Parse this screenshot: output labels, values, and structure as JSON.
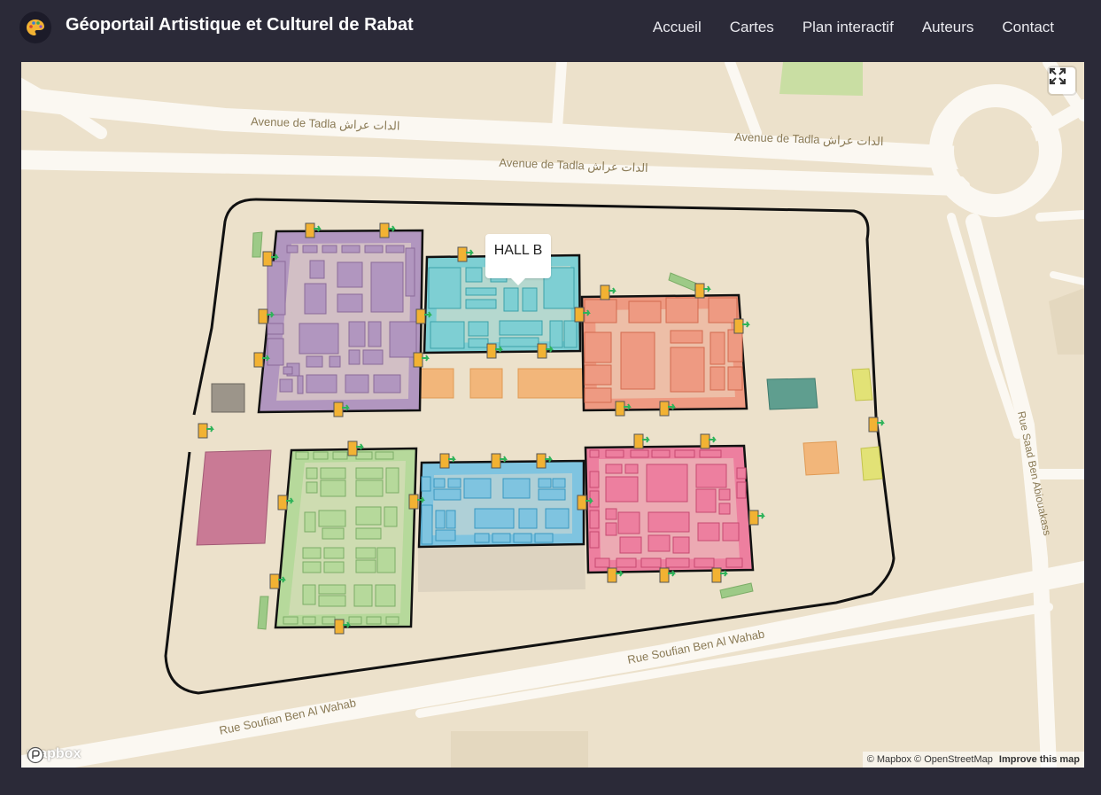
{
  "header": {
    "title": "Géoportail Artistique et Culturel de Rabat",
    "nav": [
      "Accueil",
      "Cartes",
      "Plan interactif",
      "Auteurs",
      "Contact"
    ]
  },
  "map": {
    "streets": {
      "tadla": "Avenue de Tadla الدات عراش",
      "soufian": "Rue Soufian Ben Al Wahab",
      "saad": "Rue Saad Ben Abiouakass"
    },
    "popup": "HALL B",
    "logo": "mapbox",
    "attribution": "© Mapbox © OpenStreetMap",
    "improve": "Improve this map",
    "halls": [
      {
        "name": "purple",
        "color": "#b196bf"
      },
      {
        "name": "cyan",
        "color": "#7ecfd3"
      },
      {
        "name": "salmon",
        "color": "#ee9a82"
      },
      {
        "name": "green",
        "color": "#b6d99b"
      },
      {
        "name": "blue",
        "color": "#7fc4e0"
      },
      {
        "name": "pink",
        "color": "#ed7f9f"
      }
    ]
  }
}
